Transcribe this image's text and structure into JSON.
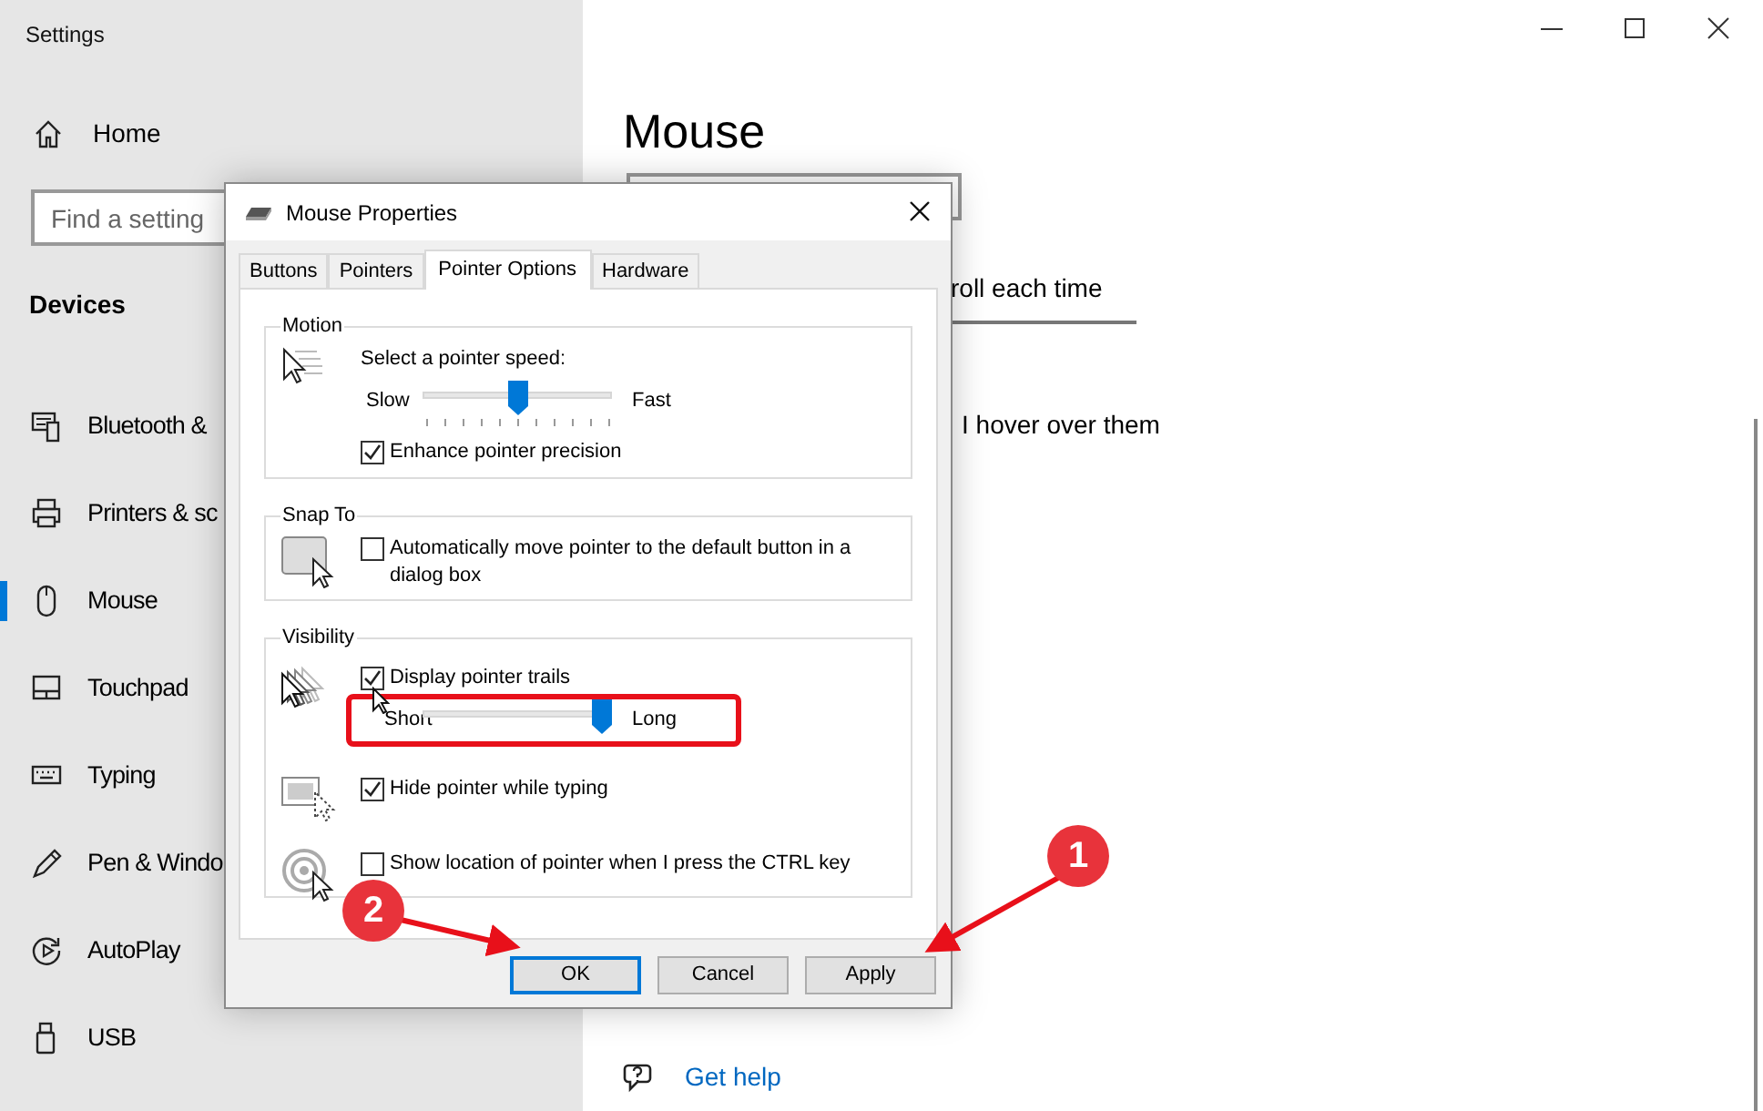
{
  "window": {
    "title": "Settings"
  },
  "sidebar": {
    "home": "Home",
    "search": {
      "placeholder": "Find a setting"
    },
    "section": "Devices",
    "items": [
      {
        "label": "Bluetooth &",
        "kind": "bluetooth",
        "selected": false
      },
      {
        "label": "Printers & sc",
        "kind": "printer",
        "selected": false
      },
      {
        "label": "Mouse",
        "kind": "mouse",
        "selected": true
      },
      {
        "label": "Touchpad",
        "kind": "touchpad",
        "selected": false
      },
      {
        "label": "Typing",
        "kind": "keyboard",
        "selected": false
      },
      {
        "label": "Pen & Windo",
        "kind": "pen",
        "selected": false
      },
      {
        "label": "AutoPlay",
        "kind": "autoplay",
        "selected": false
      },
      {
        "label": "USB",
        "kind": "usb",
        "selected": false
      }
    ]
  },
  "page": {
    "title": "Mouse",
    "scroll_text": "roll each time",
    "hover_text": "I hover over them",
    "help_link": "Get help"
  },
  "dialog": {
    "title": "Mouse Properties",
    "tabs": [
      {
        "label": "Buttons",
        "selected": false
      },
      {
        "label": "Pointers",
        "selected": false
      },
      {
        "label": "Pointer Options",
        "selected": true
      },
      {
        "label": "Hardware",
        "selected": false
      }
    ],
    "groups": [
      {
        "title": "Motion",
        "sections": [
          {
            "kind": "speed",
            "rows": [
              {
                "kind": "text",
                "label": "Select a pointer speed:"
              },
              {
                "kind": "slider",
                "min_label": "Slow",
                "max_label": "Fast",
                "level": 0.5
              },
              {
                "kind": "checkbox",
                "label": "Enhance pointer precision",
                "checked": true
              }
            ]
          }
        ]
      },
      {
        "title": "Snap To",
        "sections": [
          {
            "kind": "snap",
            "rows": [
              {
                "kind": "checkbox",
                "label": "Automatically move pointer to the default button in a dialog box",
                "checked": false
              }
            ]
          }
        ]
      },
      {
        "title": "Visibility",
        "sections": [
          {
            "kind": "trails",
            "rows": [
              {
                "kind": "checkbox",
                "label": "Display pointer trails",
                "checked": true
              },
              {
                "kind": "slider",
                "min_label": "Short",
                "max_label": "Long",
                "level": 0.94
              }
            ]
          },
          {
            "kind": "hide",
            "rows": [
              {
                "kind": "checkbox",
                "label": "Hide pointer while typing",
                "checked": true
              }
            ]
          },
          {
            "kind": "locate",
            "rows": [
              {
                "kind": "checkbox",
                "label": "Show location of pointer when I press the CTRL key",
                "checked": false
              }
            ]
          }
        ]
      }
    ],
    "buttons": [
      {
        "label": "OK",
        "focused": true
      },
      {
        "label": "Cancel",
        "focused": false
      },
      {
        "label": "Apply",
        "focused": false
      }
    ]
  },
  "annotations": [
    "1",
    "2"
  ]
}
